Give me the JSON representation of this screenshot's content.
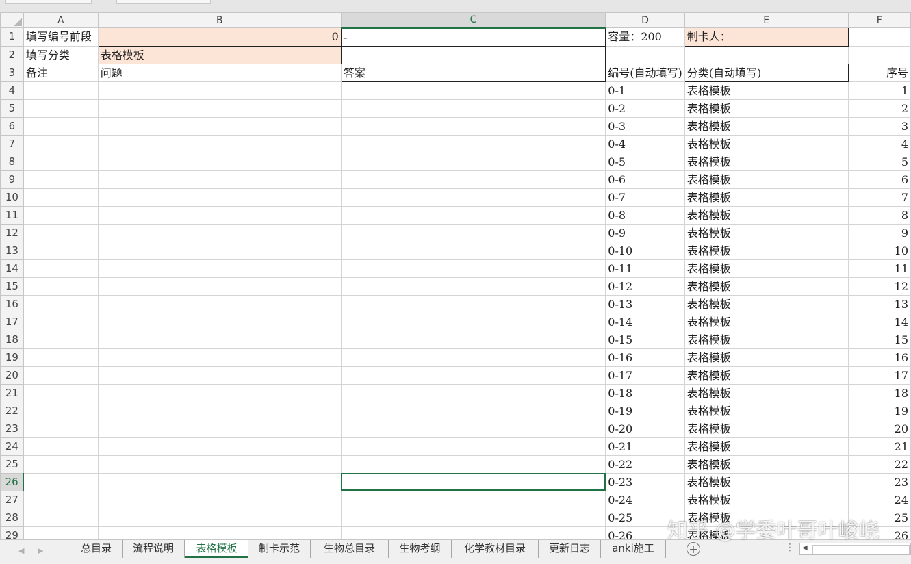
{
  "columns": [
    "A",
    "B",
    "C",
    "D",
    "E",
    "F"
  ],
  "selected_column": "C",
  "rows": [
    {
      "n": "1",
      "a": "填写编号前段",
      "b": "0",
      "c": "-",
      "d": "容量：200",
      "e": "制卡人：",
      "f": ""
    },
    {
      "n": "2",
      "a": "填写分类",
      "b": "表格模板",
      "c": "",
      "d": "",
      "e": "",
      "f": ""
    },
    {
      "n": "3",
      "a": "备注",
      "b": "问题",
      "c": "答案",
      "d": "编号(自动填写)",
      "e": "分类(自动填写)",
      "f": "序号"
    },
    {
      "n": "4",
      "a": "",
      "b": "",
      "c": "",
      "d": "0-1",
      "e": "表格模板",
      "f": "1"
    },
    {
      "n": "5",
      "a": "",
      "b": "",
      "c": "",
      "d": "0-2",
      "e": "表格模板",
      "f": "2"
    },
    {
      "n": "6",
      "a": "",
      "b": "",
      "c": "",
      "d": "0-3",
      "e": "表格模板",
      "f": "3"
    },
    {
      "n": "7",
      "a": "",
      "b": "",
      "c": "",
      "d": "0-4",
      "e": "表格模板",
      "f": "4"
    },
    {
      "n": "8",
      "a": "",
      "b": "",
      "c": "",
      "d": "0-5",
      "e": "表格模板",
      "f": "5"
    },
    {
      "n": "9",
      "a": "",
      "b": "",
      "c": "",
      "d": "0-6",
      "e": "表格模板",
      "f": "6"
    },
    {
      "n": "10",
      "a": "",
      "b": "",
      "c": "",
      "d": "0-7",
      "e": "表格模板",
      "f": "7"
    },
    {
      "n": "11",
      "a": "",
      "b": "",
      "c": "",
      "d": "0-8",
      "e": "表格模板",
      "f": "8"
    },
    {
      "n": "12",
      "a": "",
      "b": "",
      "c": "",
      "d": "0-9",
      "e": "表格模板",
      "f": "9"
    },
    {
      "n": "13",
      "a": "",
      "b": "",
      "c": "",
      "d": "0-10",
      "e": "表格模板",
      "f": "10"
    },
    {
      "n": "14",
      "a": "",
      "b": "",
      "c": "",
      "d": "0-11",
      "e": "表格模板",
      "f": "11"
    },
    {
      "n": "15",
      "a": "",
      "b": "",
      "c": "",
      "d": "0-12",
      "e": "表格模板",
      "f": "12"
    },
    {
      "n": "16",
      "a": "",
      "b": "",
      "c": "",
      "d": "0-13",
      "e": "表格模板",
      "f": "13"
    },
    {
      "n": "17",
      "a": "",
      "b": "",
      "c": "",
      "d": "0-14",
      "e": "表格模板",
      "f": "14"
    },
    {
      "n": "18",
      "a": "",
      "b": "",
      "c": "",
      "d": "0-15",
      "e": "表格模板",
      "f": "15"
    },
    {
      "n": "19",
      "a": "",
      "b": "",
      "c": "",
      "d": "0-16",
      "e": "表格模板",
      "f": "16"
    },
    {
      "n": "20",
      "a": "",
      "b": "",
      "c": "",
      "d": "0-17",
      "e": "表格模板",
      "f": "17"
    },
    {
      "n": "21",
      "a": "",
      "b": "",
      "c": "",
      "d": "0-18",
      "e": "表格模板",
      "f": "18"
    },
    {
      "n": "22",
      "a": "",
      "b": "",
      "c": "",
      "d": "0-19",
      "e": "表格模板",
      "f": "19"
    },
    {
      "n": "23",
      "a": "",
      "b": "",
      "c": "",
      "d": "0-20",
      "e": "表格模板",
      "f": "20"
    },
    {
      "n": "24",
      "a": "",
      "b": "",
      "c": "",
      "d": "0-21",
      "e": "表格模板",
      "f": "21"
    },
    {
      "n": "25",
      "a": "",
      "b": "",
      "c": "",
      "d": "0-22",
      "e": "表格模板",
      "f": "22"
    },
    {
      "n": "26",
      "a": "",
      "b": "",
      "c": "",
      "d": "0-23",
      "e": "表格模板",
      "f": "23"
    },
    {
      "n": "27",
      "a": "",
      "b": "",
      "c": "",
      "d": "0-24",
      "e": "表格模板",
      "f": "24"
    },
    {
      "n": "28",
      "a": "",
      "b": "",
      "c": "",
      "d": "0-25",
      "e": "表格模板",
      "f": "25"
    },
    {
      "n": "29",
      "a": "",
      "b": "",
      "c": "",
      "d": "0-26",
      "e": "表格模板",
      "f": "26"
    }
  ],
  "active_cell": {
    "row": "26",
    "col": "C"
  },
  "sheet_tabs": [
    "总目录",
    "流程说明",
    "表格模板",
    "制卡示范",
    "生物总目录",
    "生物考纲",
    "化学教材目录",
    "更新日志",
    "anki施工"
  ],
  "active_sheet": "表格模板",
  "add_sheet_symbol": "+",
  "watermark": "知乎 @学委叶哥叶峻峣",
  "colors": {
    "accent": "#217346",
    "peach": "#fce4d6",
    "header_bg": "#f3f3f3"
  }
}
